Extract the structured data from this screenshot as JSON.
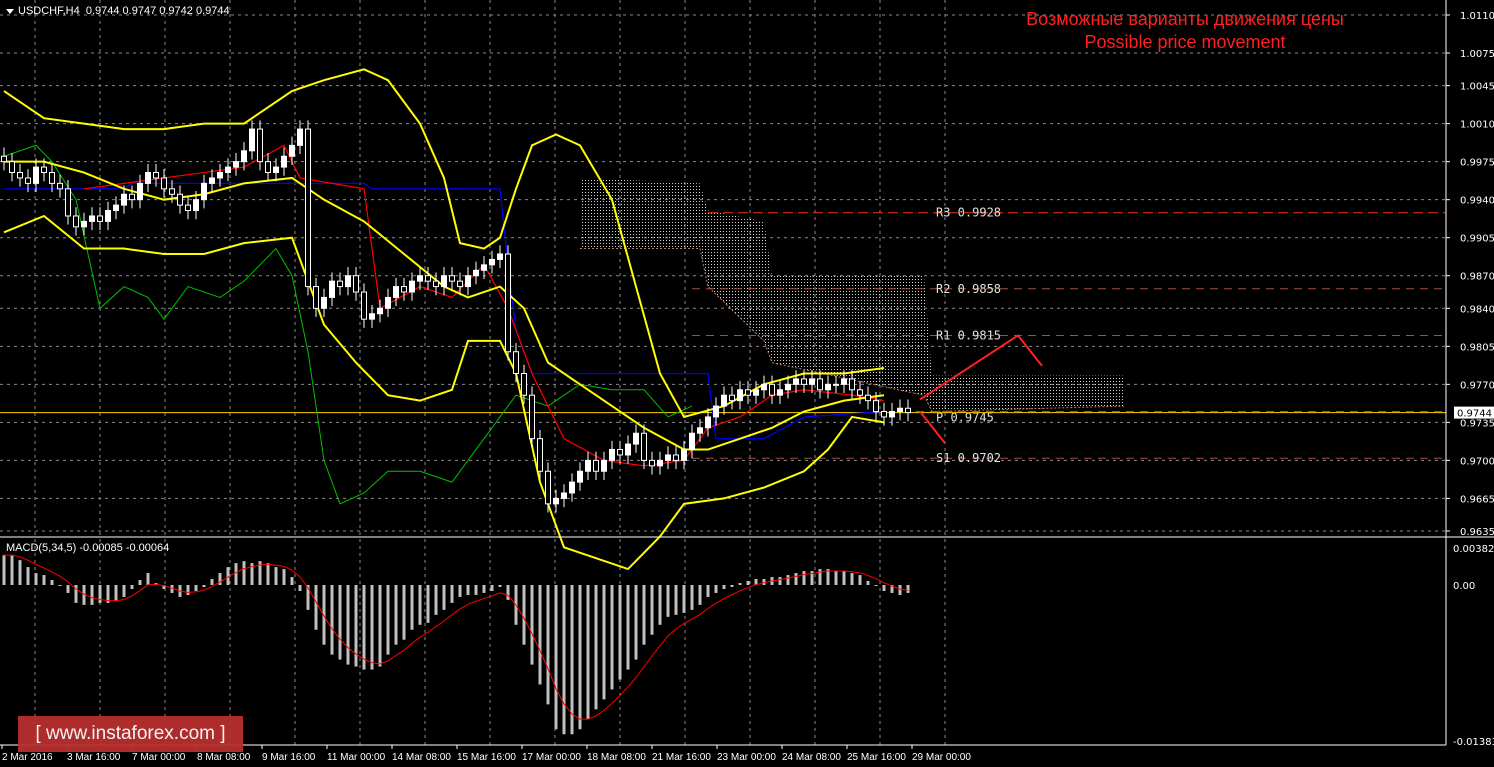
{
  "header": {
    "symbol": "USDCHF,H4",
    "ohlc": "0.9744 0.9747 0.9742 0.9744"
  },
  "title": {
    "line1": "Возможные варианты движения цены",
    "line2": "Possible price movement"
  },
  "macd_label": "MACD(5,34,5) -0.00085 -0.00064",
  "logo": "[ www.instaforex.com ]",
  "colors": {
    "bg": "#000000",
    "grid": "#8a8a8a",
    "bull": "#ffffff",
    "bear": "#ffffff",
    "bands": "#ffff00",
    "tenkan": "#ff0000",
    "kijun": "#0000ff",
    "chikou": "#00c000",
    "pivot": "#ff4020",
    "cloud": "#c8c8c8",
    "macd_hist": "#c0c0c0",
    "macd_signal": "#ff0000",
    "forecast": "#ff2020"
  },
  "chart_data": {
    "type": "candlestick",
    "symbol": "USDCHF",
    "timeframe": "H4",
    "ylim": [
      0.9635,
      1.011
    ],
    "y_ticks": [
      "1.0110",
      "1.0075",
      "1.0045",
      "1.0010",
      "0.9975",
      "0.9940",
      "0.9905",
      "0.9870",
      "0.9840",
      "0.9805",
      "0.9770",
      "0.9735",
      "0.9700",
      "0.9665",
      "0.9635"
    ],
    "x_ticks": [
      "2 Mar 2016",
      "3 Mar 16:00",
      "7 Mar 00:00",
      "8 Mar 08:00",
      "9 Mar 16:00",
      "11 Mar 00:00",
      "14 Mar 08:00",
      "15 Mar 16:00",
      "17 Mar 00:00",
      "18 Mar 08:00",
      "21 Mar 16:00",
      "23 Mar 00:00",
      "24 Mar 08:00",
      "25 Mar 16:00",
      "29 Mar 00:00"
    ],
    "current_price": "0.9744",
    "closes": [
      0.9975,
      0.9965,
      0.996,
      0.9955,
      0.997,
      0.9965,
      0.9955,
      0.995,
      0.9925,
      0.9915,
      0.992,
      0.9925,
      0.992,
      0.993,
      0.9935,
      0.9945,
      0.994,
      0.9955,
      0.9965,
      0.996,
      0.995,
      0.9945,
      0.9935,
      0.993,
      0.994,
      0.9955,
      0.996,
      0.9965,
      0.997,
      0.9975,
      0.9985,
      1.0005,
      0.9975,
      0.9965,
      0.997,
      0.998,
      0.999,
      1.0005,
      0.986,
      0.984,
      0.985,
      0.9865,
      0.986,
      0.987,
      0.9855,
      0.983,
      0.9835,
      0.984,
      0.985,
      0.986,
      0.9855,
      0.9865,
      0.987,
      0.9865,
      0.986,
      0.987,
      0.9865,
      0.986,
      0.987,
      0.9875,
      0.988,
      0.9885,
      0.989,
      0.98,
      0.978,
      0.976,
      0.972,
      0.969,
      0.966,
      0.9665,
      0.967,
      0.968,
      0.969,
      0.97,
      0.969,
      0.97,
      0.971,
      0.9705,
      0.9715,
      0.9725,
      0.97,
      0.9695,
      0.97,
      0.9705,
      0.97,
      0.971,
      0.9725,
      0.973,
      0.974,
      0.975,
      0.976,
      0.9755,
      0.9765,
      0.976,
      0.9765,
      0.977,
      0.976,
      0.9765,
      0.977,
      0.9775,
      0.977,
      0.9775,
      0.9765,
      0.977,
      0.977,
      0.9775,
      0.9765,
      0.976,
      0.9755,
      0.9745,
      0.974,
      0.9745,
      0.9748,
      0.9744
    ],
    "bollinger": {
      "upper": [
        [
          0,
          1.004
        ],
        [
          5,
          1.0015
        ],
        [
          10,
          1.001
        ],
        [
          15,
          1.0005
        ],
        [
          20,
          1.0005
        ],
        [
          25,
          1.001
        ],
        [
          30,
          1.001
        ],
        [
          36,
          1.004
        ],
        [
          40,
          1.005
        ],
        [
          45,
          1.006
        ],
        [
          48,
          1.005
        ],
        [
          52,
          1.001
        ],
        [
          55,
          0.996
        ],
        [
          57,
          0.99
        ],
        [
          60,
          0.9895
        ],
        [
          62,
          0.9905
        ],
        [
          64,
          0.995
        ],
        [
          66,
          0.999
        ],
        [
          69,
          1.0
        ],
        [
          72,
          0.999
        ],
        [
          76,
          0.994
        ],
        [
          79,
          0.986
        ],
        [
          82,
          0.978
        ],
        [
          85,
          0.974
        ],
        [
          90,
          0.975
        ],
        [
          95,
          0.977
        ],
        [
          100,
          0.978
        ],
        [
          105,
          0.978
        ],
        [
          110,
          0.9785
        ]
      ],
      "middle": [
        [
          0,
          0.9975
        ],
        [
          5,
          0.9975
        ],
        [
          10,
          0.9965
        ],
        [
          15,
          0.995
        ],
        [
          20,
          0.994
        ],
        [
          25,
          0.9945
        ],
        [
          30,
          0.9955
        ],
        [
          36,
          0.996
        ],
        [
          40,
          0.994
        ],
        [
          45,
          0.992
        ],
        [
          50,
          0.989
        ],
        [
          55,
          0.986
        ],
        [
          58,
          0.985
        ],
        [
          62,
          0.986
        ],
        [
          65,
          0.984
        ],
        [
          68,
          0.979
        ],
        [
          72,
          0.977
        ],
        [
          76,
          0.975
        ],
        [
          80,
          0.973
        ],
        [
          85,
          0.971
        ],
        [
          88,
          0.971
        ],
        [
          92,
          0.972
        ],
        [
          96,
          0.973
        ],
        [
          100,
          0.9745
        ],
        [
          105,
          0.9755
        ],
        [
          110,
          0.976
        ]
      ],
      "lower": [
        [
          0,
          0.991
        ],
        [
          5,
          0.9925
        ],
        [
          10,
          0.9895
        ],
        [
          15,
          0.9895
        ],
        [
          20,
          0.989
        ],
        [
          25,
          0.989
        ],
        [
          30,
          0.99
        ],
        [
          36,
          0.9905
        ],
        [
          40,
          0.9825
        ],
        [
          44,
          0.979
        ],
        [
          48,
          0.976
        ],
        [
          52,
          0.9755
        ],
        [
          56,
          0.9765
        ],
        [
          58,
          0.981
        ],
        [
          62,
          0.981
        ],
        [
          64,
          0.978
        ],
        [
          67,
          0.968
        ],
        [
          70,
          0.962
        ],
        [
          78,
          0.96
        ],
        [
          82,
          0.963
        ],
        [
          85,
          0.966
        ],
        [
          90,
          0.9665
        ],
        [
          95,
          0.9675
        ],
        [
          100,
          0.969
        ],
        [
          103,
          0.971
        ],
        [
          106,
          0.974
        ],
        [
          110,
          0.9735
        ]
      ]
    },
    "ichimoku": {
      "tenkan": [
        [
          10,
          0.995
        ],
        [
          20,
          0.996
        ],
        [
          30,
          0.997
        ],
        [
          35,
          0.999
        ],
        [
          37,
          0.996
        ],
        [
          45,
          0.995
        ],
        [
          47,
          0.984
        ],
        [
          52,
          0.986
        ],
        [
          56,
          0.985
        ],
        [
          60,
          0.988
        ],
        [
          63,
          0.984
        ],
        [
          66,
          0.978
        ],
        [
          70,
          0.972
        ],
        [
          75,
          0.97
        ],
        [
          80,
          0.9695
        ],
        [
          85,
          0.97
        ],
        [
          88,
          0.973
        ],
        [
          92,
          0.974
        ],
        [
          96,
          0.976
        ],
        [
          100,
          0.9765
        ],
        [
          106,
          0.976
        ],
        [
          110,
          0.9755
        ]
      ],
      "kijun": [
        [
          0,
          0.995
        ],
        [
          15,
          0.995
        ],
        [
          16,
          0.9955
        ],
        [
          45,
          0.9955
        ],
        [
          46,
          0.995
        ],
        [
          62,
          0.995
        ],
        [
          63,
          0.988
        ],
        [
          64,
          0.982
        ],
        [
          66,
          0.978
        ],
        [
          88,
          0.978
        ],
        [
          89,
          0.972
        ],
        [
          95,
          0.972
        ],
        [
          100,
          0.974
        ],
        [
          110,
          0.9745
        ]
      ],
      "chikou": [
        [
          0,
          0.998
        ],
        [
          4,
          0.999
        ],
        [
          6,
          0.9975
        ],
        [
          9,
          0.994
        ],
        [
          12,
          0.984
        ],
        [
          15,
          0.986
        ],
        [
          18,
          0.985
        ],
        [
          20,
          0.983
        ],
        [
          23,
          0.986
        ],
        [
          27,
          0.985
        ],
        [
          30,
          0.9865
        ],
        [
          34,
          0.9895
        ],
        [
          36,
          0.987
        ],
        [
          38,
          0.98
        ],
        [
          40,
          0.97
        ],
        [
          42,
          0.966
        ],
        [
          45,
          0.967
        ],
        [
          48,
          0.969
        ],
        [
          52,
          0.969
        ],
        [
          56,
          0.968
        ],
        [
          60,
          0.972
        ],
        [
          62,
          0.974
        ],
        [
          64,
          0.976
        ],
        [
          68,
          0.975
        ],
        [
          72,
          0.977
        ],
        [
          76,
          0.9765
        ],
        [
          80,
          0.9765
        ],
        [
          83,
          0.974
        ],
        [
          86,
          0.975
        ]
      ],
      "cloud": [
        [
          72,
          0.996,
          0.9895
        ],
        [
          87,
          0.9955,
          0.9895
        ],
        [
          88,
          0.993,
          0.986
        ],
        [
          95,
          0.992,
          0.981
        ],
        [
          96,
          0.987,
          0.979
        ],
        [
          115,
          0.987,
          0.976
        ],
        [
          116,
          0.9778,
          0.9745
        ],
        [
          140,
          0.9778,
          0.975
        ]
      ]
    },
    "pivots": [
      {
        "label": "R3",
        "value": "0.9928",
        "from_bar": 88
      },
      {
        "label": "R2",
        "value": "0.9858",
        "from_bar": 86
      },
      {
        "label": "R1",
        "value": "0.9815",
        "from_bar": 86
      },
      {
        "label": "P",
        "value": "0.9745",
        "from_bar": 114
      },
      {
        "label": "S1",
        "value": "0.9702",
        "from_bar": 86
      }
    ],
    "forecast": {
      "bullish": [
        [
          114.5,
          0.9756
        ],
        [
          126.75,
          0.9815
        ],
        [
          129.75,
          0.9787
        ]
      ],
      "bearish": [
        [
          114.5,
          0.9745
        ],
        [
          117.6,
          0.9716
        ]
      ]
    },
    "macd": {
      "params": "5,34,5",
      "ylim": [
        -0.01383,
        0.00382
      ],
      "y_ticks": [
        "0.00382",
        "0.00",
        "-0.01383"
      ],
      "histogram": [
        0.003,
        0.003,
        0.0025,
        0.0018,
        0.0012,
        0.001,
        0.0005,
        0.0,
        -0.0008,
        -0.0018,
        -0.002,
        -0.002,
        -0.0018,
        -0.0018,
        -0.0016,
        -0.0012,
        -0.0004,
        0.0005,
        0.0012,
        0.0002,
        -0.0004,
        -0.0008,
        -0.0012,
        -0.001,
        -0.0006,
        -0.0002,
        0.0006,
        0.0012,
        0.0018,
        0.0022,
        0.0024,
        0.0022,
        0.0024,
        0.0022,
        0.0018,
        0.0016,
        0.0008,
        -0.0006,
        -0.0025,
        -0.0045,
        -0.006,
        -0.007,
        -0.0075,
        -0.008,
        -0.0082,
        -0.0085,
        -0.0085,
        -0.0082,
        -0.007,
        -0.006,
        -0.0055,
        -0.0045,
        -0.004,
        -0.0038,
        -0.003,
        -0.0025,
        -0.0018,
        -0.0012,
        -0.001,
        -0.001,
        -0.0008,
        -0.0006,
        -0.0002,
        -0.0015,
        -0.004,
        -0.006,
        -0.008,
        -0.01,
        -0.012,
        -0.0145,
        -0.015,
        -0.015,
        -0.0145,
        -0.0135,
        -0.0125,
        -0.0115,
        -0.0105,
        -0.0095,
        -0.0085,
        -0.0075,
        -0.006,
        -0.005,
        -0.004,
        -0.0032,
        -0.003,
        -0.0028,
        -0.0025,
        -0.002,
        -0.0012,
        -0.0008,
        -0.0004,
        -0.0002,
        0.0002,
        0.0004,
        0.0006,
        0.0006,
        0.0008,
        0.0008,
        0.001,
        0.0012,
        0.0014,
        0.0014,
        0.0016,
        0.0016,
        0.0014,
        0.0014,
        0.0012,
        0.001,
        0.0004,
        0.0,
        -0.0006,
        -0.0008,
        -0.001,
        -0.0008
      ]
    }
  }
}
